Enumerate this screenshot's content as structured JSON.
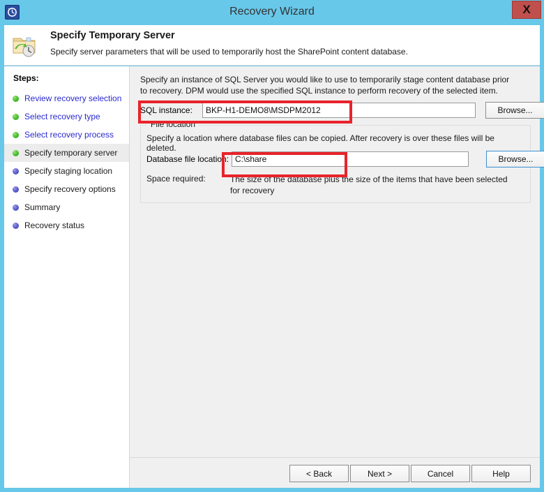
{
  "window": {
    "title": "Recovery Wizard",
    "app_icon": "recovery-clock-icon",
    "close_label": "X"
  },
  "header": {
    "icon": "folder-restore-icon",
    "title": "Specify Temporary Server",
    "subtitle": "Specify server parameters that will be used to temporarily host the SharePoint content database."
  },
  "sidebar": {
    "label": "Steps:",
    "items": [
      {
        "label": "Review recovery selection",
        "state": "done"
      },
      {
        "label": "Select recovery type",
        "state": "done"
      },
      {
        "label": "Select recovery process",
        "state": "done"
      },
      {
        "label": "Specify temporary server",
        "state": "current"
      },
      {
        "label": "Specify staging location",
        "state": "pending"
      },
      {
        "label": "Specify recovery options",
        "state": "pending"
      },
      {
        "label": "Summary",
        "state": "pending"
      },
      {
        "label": "Recovery status",
        "state": "pending"
      }
    ]
  },
  "main": {
    "intro": "Specify an instance of SQL Server you would like to use to temporarily stage content database prior to recovery. DPM would use the specified SQL instance to perform recovery of the selected item.",
    "sql_instance": {
      "label": "SQL instance:",
      "value": "BKP-H1-DEMO8\\MSDPM2012",
      "placeholder": "",
      "browse_label": "Browse..."
    },
    "file_location": {
      "legend": "File location",
      "description": "Specify a location where database files can be copied. After recovery is over these files will be deleted.",
      "db_file_location": {
        "label": "Database file location:",
        "value": "C:\\share",
        "placeholder": "",
        "browse_label": "Browse..."
      },
      "space_required": {
        "label": "Space required:",
        "value": "The size of the database plus the size of the items that have been selected for recovery"
      }
    }
  },
  "footer": {
    "back_label": "< Back",
    "next_label": "Next >",
    "cancel_label": "Cancel",
    "help_label": "Help"
  },
  "annotations": {
    "accent_color": "#e8232a",
    "boxes": [
      "sql-instance-highlight",
      "database-file-location-highlight"
    ]
  }
}
